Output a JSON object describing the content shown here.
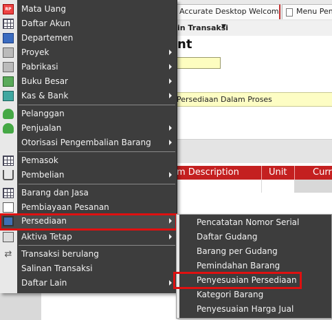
{
  "tabs": [
    {
      "label": "Accurate Desktop Welcome..."
    },
    {
      "label": "Menu Peng"
    }
  ],
  "toolbar": {
    "label": "in Transaksi"
  },
  "form": {
    "title": "nt",
    "band_text": "Persediaan Dalam Proses"
  },
  "grid": {
    "columns": [
      "m Description",
      "Unit",
      "Curr"
    ]
  },
  "menu": {
    "items": [
      {
        "label": "Mata Uang",
        "icon": "rp-currency-icon"
      },
      {
        "label": "Daftar Akun",
        "icon": "account-list-icon"
      },
      {
        "label": "Departemen",
        "icon": "department-icon"
      },
      {
        "label": "Proyek",
        "icon": "project-icon",
        "submenu": true
      },
      {
        "label": "Pabrikasi",
        "icon": "manufacturing-icon",
        "submenu": true
      },
      {
        "label": "Buku Besar",
        "icon": "ledger-icon",
        "submenu": true
      },
      {
        "label": "Kas & Bank",
        "icon": "cash-bank-icon",
        "submenu": true
      },
      {
        "label": "Pelanggan",
        "icon": "customer-icon"
      },
      {
        "label": "Penjualan",
        "icon": "sales-icon",
        "submenu": true
      },
      {
        "label": "Otorisasi Pengembalian Barang",
        "icon": "",
        "submenu": true
      },
      {
        "label": "Pemasok",
        "icon": "supplier-icon"
      },
      {
        "label": "Pembelian",
        "icon": "cart-icon",
        "submenu": true
      },
      {
        "label": "Barang dan Jasa",
        "icon": "items-grid-icon"
      },
      {
        "label": "Pembiayaan Pesanan",
        "icon": "order-financing-icon"
      },
      {
        "label": "Persediaan",
        "icon": "inventory-monitor-icon",
        "submenu": true,
        "highlighted": true
      },
      {
        "label": "Aktiva Tetap",
        "icon": "fixed-asset-house-icon",
        "submenu": true
      },
      {
        "label": "Transaksi berulang",
        "icon": "recurring-arrows-icon"
      },
      {
        "label": "Salinan Transaksi",
        "icon": "transaction-copy-icon"
      },
      {
        "label": "Daftar Lain",
        "icon": "other-list-icon",
        "submenu": true
      }
    ]
  },
  "submenu": {
    "items": [
      {
        "label": "Pencatatan Nomor Serial"
      },
      {
        "label": "Daftar Gudang"
      },
      {
        "label": "Barang per Gudang"
      },
      {
        "label": "Pemindahan Barang"
      },
      {
        "label": "Penyesuaian Persediaan",
        "highlighted": true
      },
      {
        "label": "Kategori Barang"
      },
      {
        "label": "Penyesuaian Harga Jual"
      }
    ]
  },
  "colors": {
    "menu_bg": "#3d3d3d",
    "highlight_border": "#e01010",
    "grid_header": "#c42020",
    "yellow_field": "#fdfdc0"
  }
}
